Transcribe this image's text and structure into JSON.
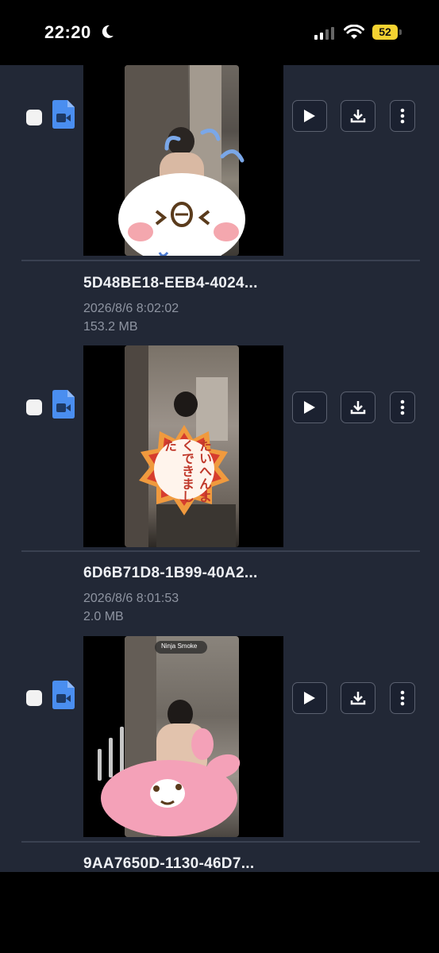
{
  "status_bar": {
    "time": "22:20",
    "battery": "52",
    "battery_color": "#f5d331"
  },
  "colors": {
    "background": "#222836",
    "file_icon": "#4a8ef0",
    "button_border": "#5b6170"
  },
  "files": [
    {
      "name": "5D48BE18-EEB4-4024...",
      "date": "",
      "size": "",
      "sticker_icon": "white-blob-face-sticker-icon"
    },
    {
      "name": "6D6B71D8-1B99-40A2...",
      "date": "2026/8/6 8:02:02",
      "size": "153.2 MB",
      "sticker_text": "たいへんよくできました",
      "sticker_icon": "flower-stamp-sticker-icon"
    },
    {
      "name": "9AA7650D-1130-46D7...",
      "date": "2026/8/6 8:01:53",
      "size": "2.0 MB",
      "sticker_icon": "pink-rabbit-sticker-icon",
      "overlay_chip": "Ninja Smoke"
    }
  ]
}
